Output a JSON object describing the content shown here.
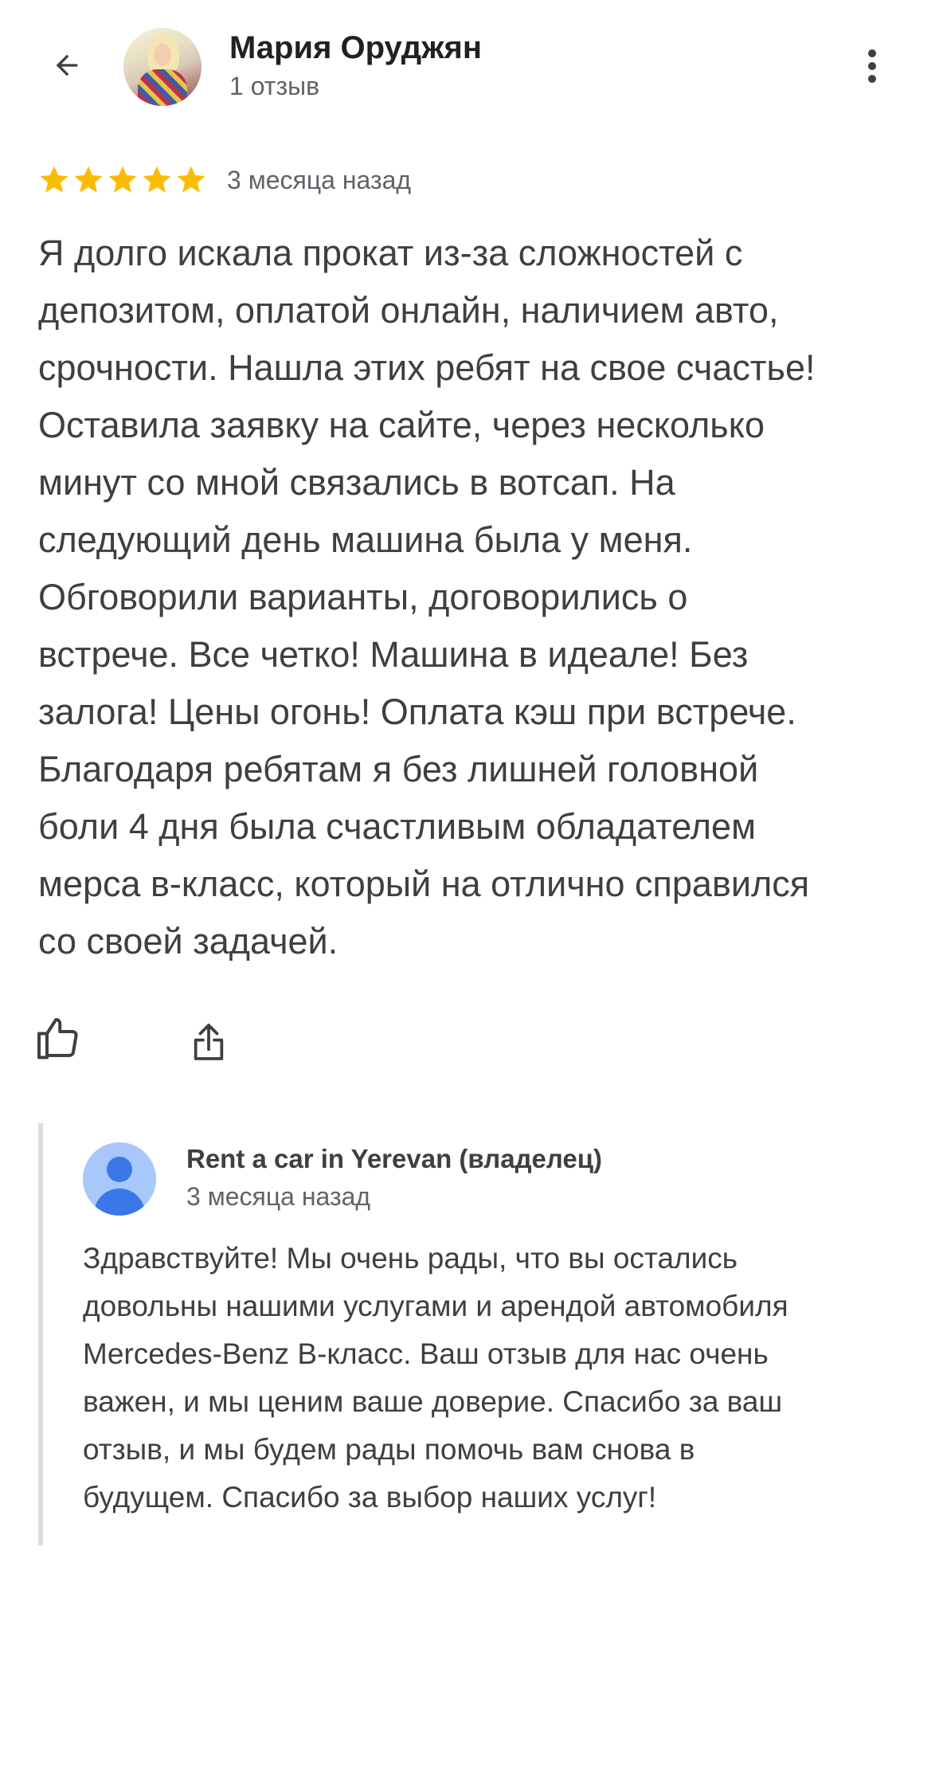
{
  "header": {
    "back_icon": "arrow-back-icon",
    "user_name": "Мария Оруджян",
    "review_count": "1 отзыв",
    "more_icon": "more-vert-icon"
  },
  "review": {
    "rating": 5,
    "max_rating": 5,
    "star_color": "#fbbc04",
    "date": "3 месяца назад",
    "text": "Я долго искала прокат из-за сложностей с\nдепозитом, оплатой онлайн, наличием авто,\nсрочности. Нашла этих ребят на свое счастье!\nОставила заявку на сайте, через несколько\nминут со мной связались в вотсап. На\nследующий день машина была у меня.\nОбговорили варианты, договорились о\nвстрече. Все четко! Машина в идеале! Без\nзалога! Цены огонь! Оплата кэш при встрече.\nБлагодаря ребятам я без лишней головной\nболи 4 дня была счастливым обладателем\nмерса в-класс, который на отлично справился\nсо своей задачей."
  },
  "actions": {
    "like_icon": "thumb-up-icon",
    "share_icon": "share-icon"
  },
  "owner_reply": {
    "name": "Rent a car in Yerevan (владелец)",
    "date": "3 месяца назад",
    "avatar_color": "#3b78e7",
    "text": "Здравствуйте! Мы очень рады, что вы остались\nдовольны нашими услугами и арендой автомобиля\nMercedes-Benz B-класс. Ваш отзыв для нас очень\nважен, и мы ценим ваше доверие. Спасибо за ваш\nотзыв, и мы будем рады помочь вам снова в\nбудущем. Спасибо за выбор наших услуг!"
  }
}
